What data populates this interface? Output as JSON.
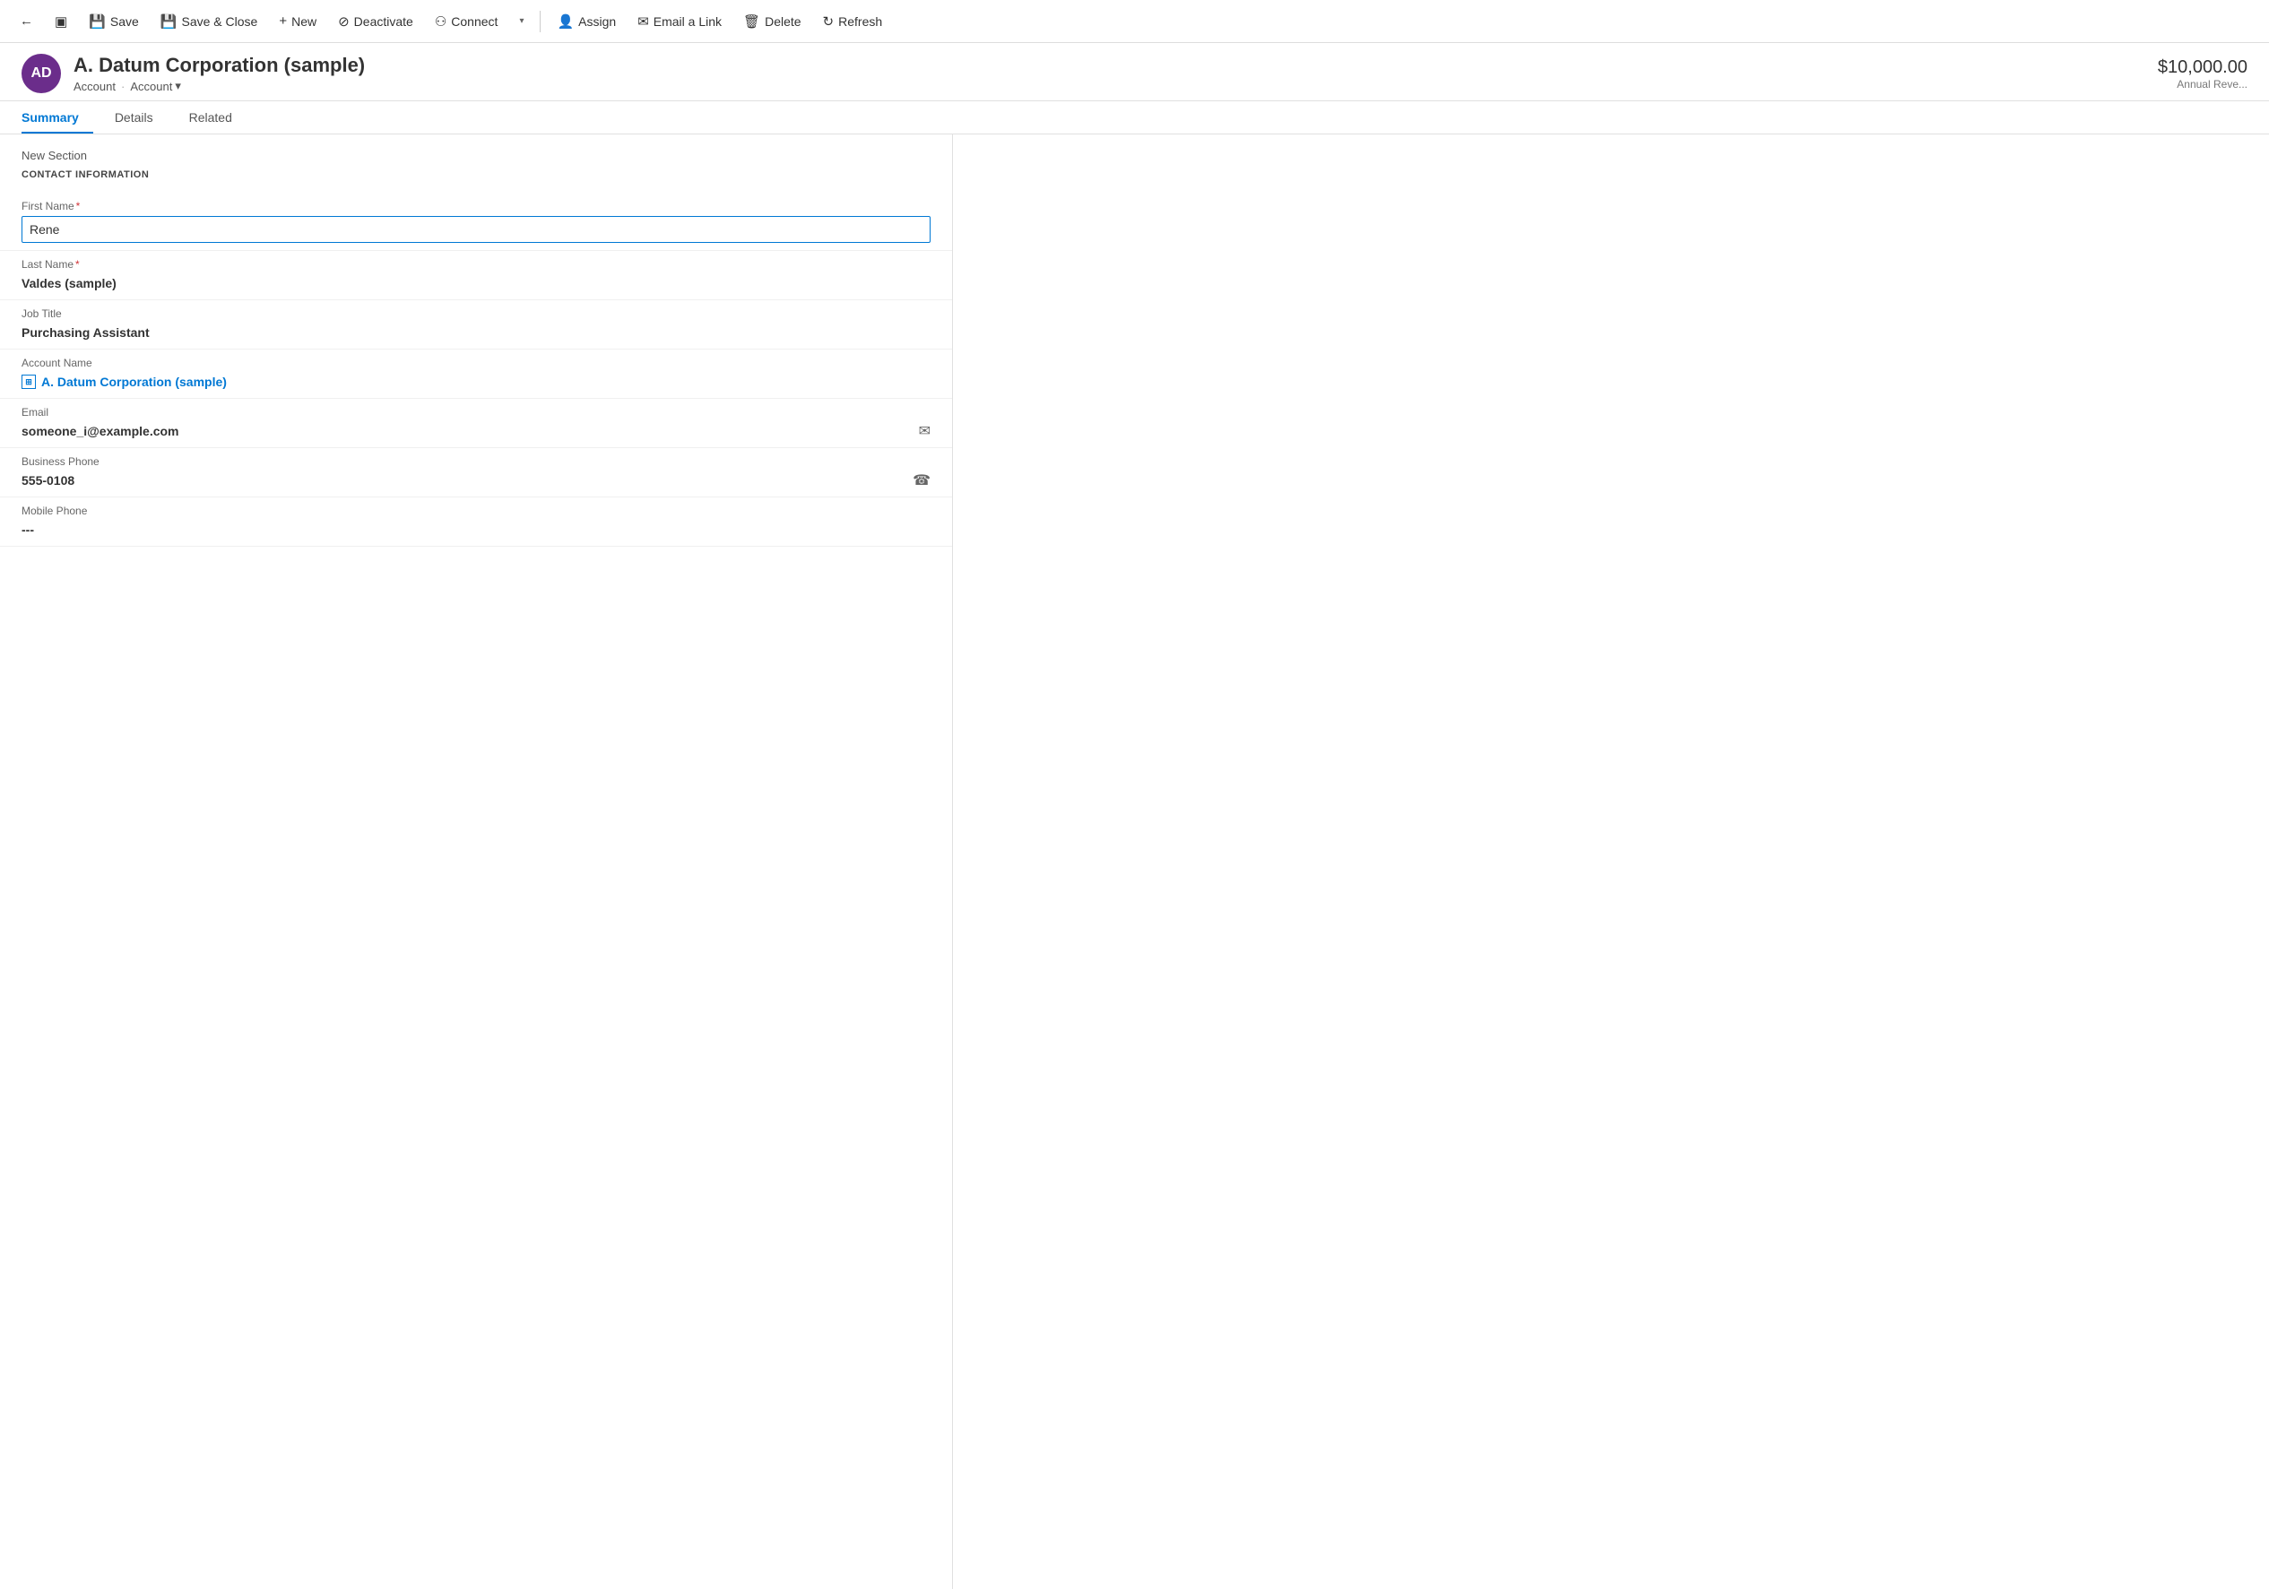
{
  "toolbar": {
    "back_icon": "←",
    "document_icon": "▣",
    "save_label": "Save",
    "save_icon": "💾",
    "save_close_label": "Save & Close",
    "save_close_icon": "💾",
    "new_label": "New",
    "new_icon": "+",
    "deactivate_label": "Deactivate",
    "deactivate_icon": "⊘",
    "connect_label": "Connect",
    "connect_icon": "⚇",
    "dropdown_arrow": "▾",
    "assign_label": "Assign",
    "assign_icon": "👤",
    "email_link_label": "Email a Link",
    "email_link_icon": "✉",
    "delete_label": "Delete",
    "delete_icon": "🗑",
    "refresh_label": "Refresh",
    "refresh_icon": "↻"
  },
  "record": {
    "avatar_initials": "AD",
    "title": "A. Datum Corporation (sample)",
    "breadcrumb1": "Account",
    "breadcrumb_sep": "·",
    "breadcrumb2": "Account",
    "annual_revenue": "$10,000.00",
    "annual_revenue_label": "Annual Reve..."
  },
  "tabs": [
    {
      "label": "Summary",
      "active": true
    },
    {
      "label": "Details",
      "active": false
    },
    {
      "label": "Related",
      "active": false
    }
  ],
  "form": {
    "new_section_label": "New Section",
    "contact_info_heading": "CONTACT INFORMATION",
    "fields": {
      "first_name_label": "First Name",
      "first_name_required": "*",
      "first_name_value": "Rene",
      "last_name_label": "Last Name",
      "last_name_required": "*",
      "last_name_value": "Valdes (sample)",
      "job_title_label": "Job Title",
      "job_title_value": "Purchasing Assistant",
      "account_name_label": "Account Name",
      "account_name_value": "A. Datum Corporation (sample)",
      "email_label": "Email",
      "email_value": "someone_i@example.com",
      "business_phone_label": "Business Phone",
      "business_phone_value": "555-0108",
      "mobile_phone_label": "Mobile Phone",
      "mobile_phone_value": "---"
    }
  },
  "icons": {
    "email_icon": "✉",
    "phone_icon": "☎",
    "account_link_icon": "⊞",
    "chevron_down": "▾"
  }
}
